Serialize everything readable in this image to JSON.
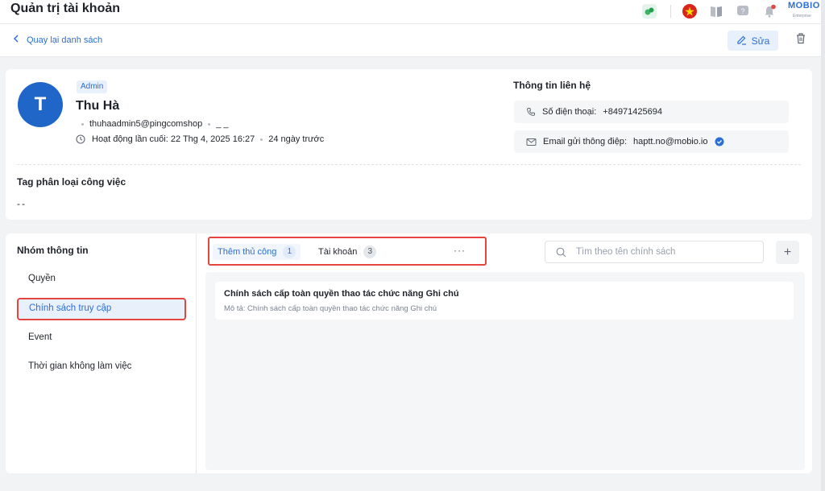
{
  "header": {
    "title": "Quản trị tài khoản",
    "brand": "MOBIO",
    "brand_sub": "Enterprise"
  },
  "subheader": {
    "back_label": "Quay lại danh sách",
    "edit_label": "Sửa"
  },
  "profile": {
    "avatar_letter": "T",
    "role": "Admin",
    "name": "Thu Hà",
    "username": "thuhaadmin5@pingcomshop",
    "extra": "_ _",
    "last_active": "Hoạt động lần cuối: 22 Thg 4, 2025 16:27",
    "last_active_ago": "24 ngày trước"
  },
  "contact": {
    "title": "Thông tin liên hệ",
    "phone_label": "Số điện thoại:",
    "phone": "+84971425694",
    "email_label": "Email gửi thông điệp:",
    "email": "haptt.no@mobio.io"
  },
  "tags": {
    "title": "Tag phân loại công việc",
    "value": "--"
  },
  "info_groups": {
    "title": "Nhóm thông tin",
    "items": [
      "Quyền",
      "Chính sách truy cập",
      "Event",
      "Thời gian không làm việc"
    ],
    "active_index": 1
  },
  "tabs": [
    {
      "label": "Thêm thủ công",
      "count": "1"
    },
    {
      "label": "Tài khoản",
      "count": "3"
    }
  ],
  "more_label": "···",
  "search": {
    "placeholder": "Tìm theo tên chính sách"
  },
  "add_label": "+",
  "policies": [
    {
      "title": "Chính sách cấp toàn quyền thao tác chức năng Ghi chú",
      "desc": "Mô tả: Chính sách cấp toàn quyền thao tác chức năng Ghi chú"
    }
  ],
  "colors": {
    "accent": "#2b6fd6",
    "highlight_border": "#e4453f",
    "avatar_bg": "#1f66c8"
  }
}
